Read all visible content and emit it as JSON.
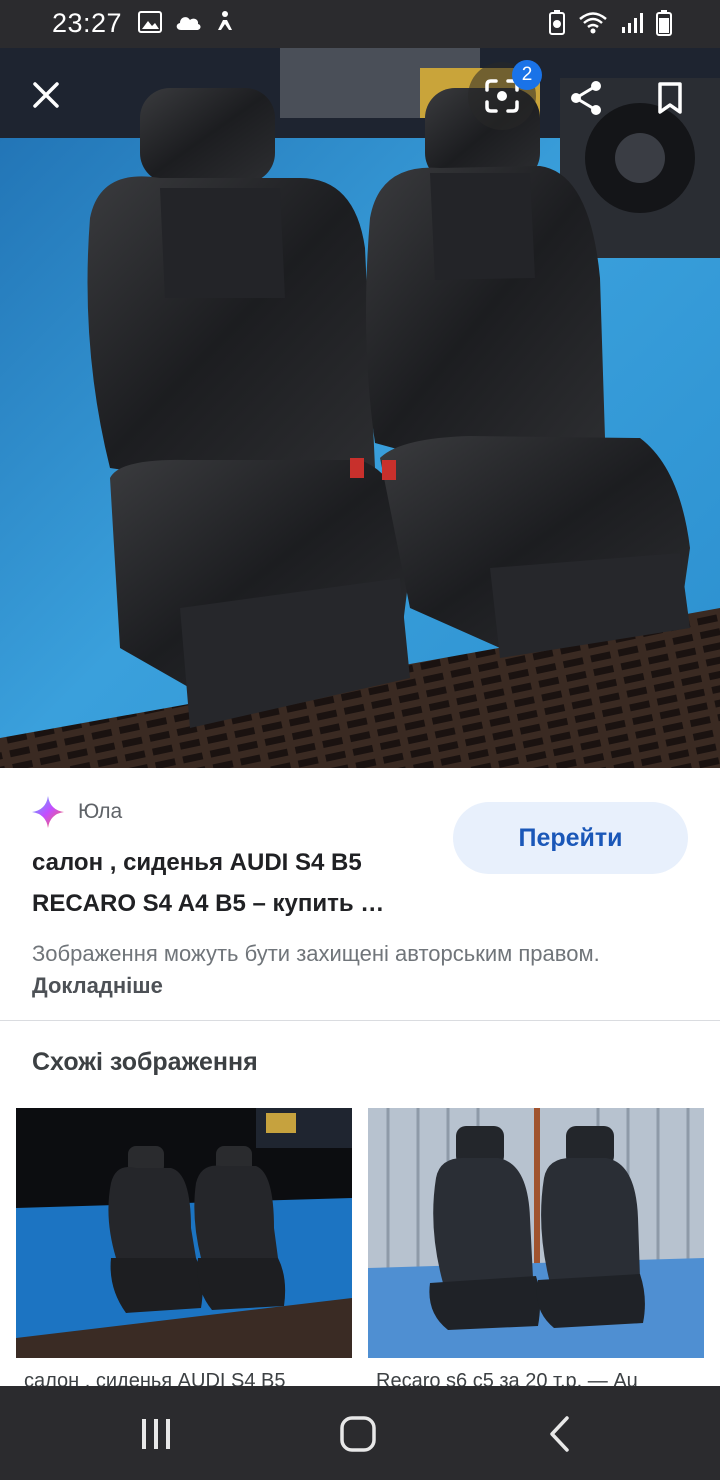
{
  "status_bar": {
    "time": "23:27",
    "left_icons": [
      "image-icon",
      "cloud-icon",
      "accessibility-icon"
    ],
    "right_icons": [
      "battery-saver-icon",
      "wifi-icon",
      "signal-icon",
      "battery-icon"
    ]
  },
  "viewer": {
    "close_icon": "close-icon",
    "lens_icon": "google-lens-icon",
    "lens_badge_count": "2",
    "share_icon": "share-icon",
    "bookmark_icon": "bookmark-icon"
  },
  "result": {
    "source_icon": "sparkle-icon",
    "source_name": "Юла",
    "goto_label": "Перейти",
    "title": "салон , сиденья AUDI S4 B5 RECARO S4 A4 B5 – купить …",
    "copyright_text": "Зображення можуть бути захищені авторським правом.",
    "copyright_link": "Докладніше"
  },
  "similar": {
    "heading": "Схожі зображення",
    "items": [
      {
        "caption": "салон , сиденья AUDI S4 B5"
      },
      {
        "caption": "Recaro s6 c5 за 20 т.р. — Au"
      }
    ]
  },
  "nav_bar": {
    "icons": [
      "recent-apps-icon",
      "home-icon",
      "back-icon"
    ]
  },
  "colors": {
    "status_bar_bg": "#2b2b2e",
    "accent": "#1a73e8",
    "goto_button_bg": "#e8f0fc",
    "goto_button_text": "#1a57b8"
  }
}
